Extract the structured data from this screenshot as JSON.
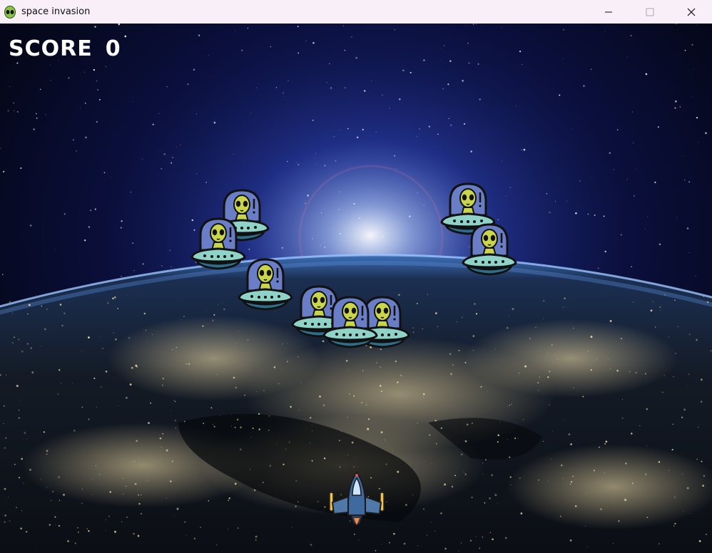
{
  "window": {
    "title": "space invasion",
    "icon": "alien-icon",
    "controls": [
      "minimize-icon",
      "maximize-icon",
      "close-icon"
    ]
  },
  "hud": {
    "score_label": "SCORE",
    "score_value": "0"
  },
  "game": {
    "background": "night-earth-from-space",
    "enemies": 10,
    "player": "spaceship-icon"
  },
  "colors": {
    "titlebar_bg": "#f8eff9",
    "score_text": "#ffffff",
    "alien_head": "#c9d64a",
    "alien_dome": "#6a7ec7",
    "saucer_body": "#8fd3c8"
  }
}
